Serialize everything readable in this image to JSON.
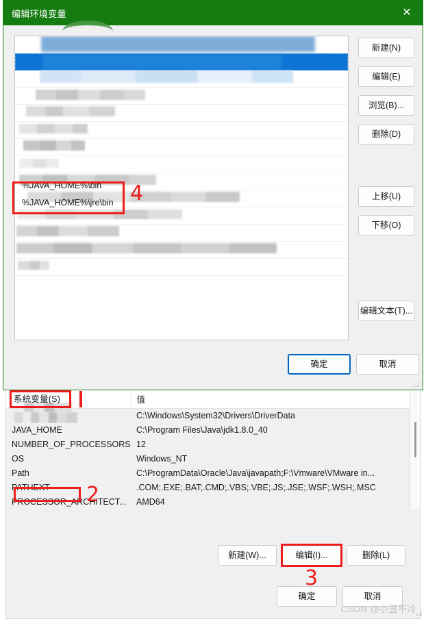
{
  "dialog": {
    "title": "编辑环境变量",
    "close_icon": "close-icon",
    "path_entries": [
      "%JAVA_HOME%\\bin",
      "%JAVA_HOME%\\jre\\bin"
    ],
    "side_buttons": [
      {
        "label": "新建(N)",
        "accel": "N"
      },
      {
        "label": "编辑(E)",
        "accel": "E"
      },
      {
        "label": "浏览(B)...",
        "accel": "B"
      },
      {
        "label": "删除(D)",
        "accel": "D"
      },
      {
        "label": "上移(U)",
        "accel": "U"
      },
      {
        "label": "下移(O)",
        "accel": "O"
      },
      {
        "label": "编辑文本(T)...",
        "accel": "T"
      }
    ],
    "ok_label": "确定",
    "cancel_label": "取消"
  },
  "system_variables": {
    "section_label": "系统变量(S)",
    "columns": [
      "",
      "值"
    ],
    "rows": [
      {
        "name": "",
        "name_blurred": true,
        "name_suffix": "ta",
        "value": "C:\\Windows\\System32\\Drivers\\DriverData",
        "selected": false
      },
      {
        "name": "JAVA_HOME",
        "name_blurred": false,
        "value": "C:\\Program Files\\Java\\jdk1.8.0_40",
        "selected": false
      },
      {
        "name": "NUMBER_OF_PROCESSORS",
        "name_blurred": false,
        "value": "12",
        "selected": false
      },
      {
        "name": "OS",
        "name_blurred": false,
        "value": "Windows_NT",
        "selected": false
      },
      {
        "name": "Path",
        "name_blurred": false,
        "value": "C:\\ProgramData\\Oracle\\Java\\javapath;F:\\Vmware\\VMware in...",
        "selected": true
      },
      {
        "name": "PATHEXT",
        "name_blurred": false,
        "value": ".COM;.EXE;.BAT;.CMD;.VBS;.VBE;.JS;.JSE;.WSF;.WSH;.MSC",
        "selected": false
      },
      {
        "name": "PROCESSOR_ARCHITECT...",
        "name_blurred": false,
        "value": "AMD64",
        "selected": false
      }
    ],
    "buttons": {
      "new_label": "新建(W)...",
      "edit_label": "编辑(I)...",
      "delete_label": "删除(L)"
    },
    "ok_label": "确定",
    "cancel_label": "取消"
  },
  "annotations": {
    "step1": "1",
    "step2": "2",
    "step3": "3",
    "step4": "4",
    "color": "#ef1c1c"
  },
  "watermark": "CSDN @小丑不冷",
  "colors": {
    "titlebar_green": "#157c12",
    "selection_blue": "#0c74d4",
    "dialog_bg": "#f0f0f0",
    "default_button_border": "#0067c0",
    "annotation_red": "#ef1c1c"
  }
}
